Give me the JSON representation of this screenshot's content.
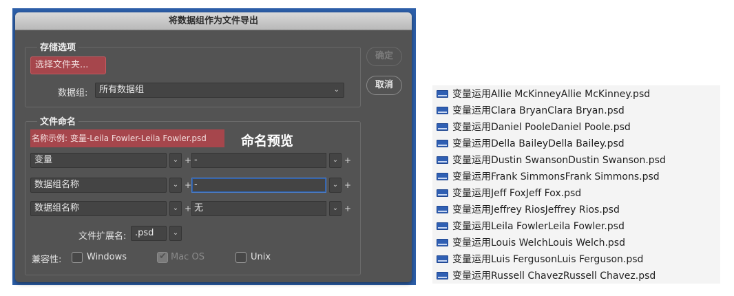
{
  "dialog": {
    "title": "将数据组作为文件导出",
    "storage": {
      "title": "存储选项",
      "choose_folder": "选择文件夹...",
      "dataset_label": "数据组:",
      "dataset_value": "所有数据组"
    },
    "naming": {
      "title": "文件命名",
      "example": "名称示例: 变量-Leila Fowler-Leila Fowler.psd",
      "rows": [
        {
          "left": "变量",
          "right": "-"
        },
        {
          "left": "数据组名称",
          "right": "-"
        },
        {
          "left": "数据组名称",
          "right": "无"
        }
      ],
      "ext_label": "文件扩展名:",
      "ext_value": ".psd"
    },
    "compat": {
      "label": "兼容性:",
      "windows": "Windows",
      "macos": "Mac OS",
      "unix": "Unix"
    },
    "ok": "确定",
    "cancel": "取消"
  },
  "annotation": "命名预览",
  "files": [
    "变量运用Allie McKinneyAllie McKinney.psd",
    "变量运用Clara BryanClara Bryan.psd",
    "变量运用Daniel PooleDaniel Poole.psd",
    "变量运用Della BaileyDella Bailey.psd",
    "变量运用Dustin SwansonDustin Swanson.psd",
    "变量运用Frank SimmonsFrank Simmons.psd",
    "变量运用Jeff FoxJeff Fox.psd",
    "变量运用Jeffrey RiosJeffrey Rios.psd",
    "变量运用Leila FowlerLeila Fowler.psd",
    "变量运用Louis WelchLouis Welch.psd",
    "变量运用Luis FergusonLuis Ferguson.psd",
    "变量运用Russell ChavezRussell Chavez.psd"
  ],
  "colors": {
    "dialog_bg": "#535353",
    "accent_red": "#a6464c",
    "focus_blue": "#4a7fd0",
    "file_icon": "#2f5fb3"
  },
  "icons": [
    "chevron-down-icon",
    "file-icon",
    "checkmark-icon"
  ]
}
